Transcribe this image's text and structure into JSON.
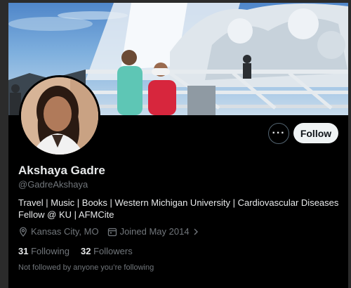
{
  "profile": {
    "name": "Akshaya Gadre",
    "handle": "@GadreAkshaya",
    "bio": "Travel | Music | Books | Western Michigan University | Cardiovascular Diseases Fellow @ KU | AFMCite",
    "location": "Kansas City, MO",
    "joined": "Joined May 2014",
    "following_count": "31",
    "following_label": "Following",
    "followers_count": "32",
    "followers_label": "Followers",
    "not_followed_text": "Not followed by anyone you’re following"
  },
  "actions": {
    "more_label": "···",
    "follow_label": "Follow"
  },
  "colors": {
    "background": "#000000",
    "text_primary": "#e7e9ea",
    "text_secondary": "#71767b",
    "follow_button_bg": "#eff3f4"
  },
  "icons": {
    "location": "location-pin-icon",
    "joined": "calendar-icon",
    "more": "more-options-icon"
  }
}
